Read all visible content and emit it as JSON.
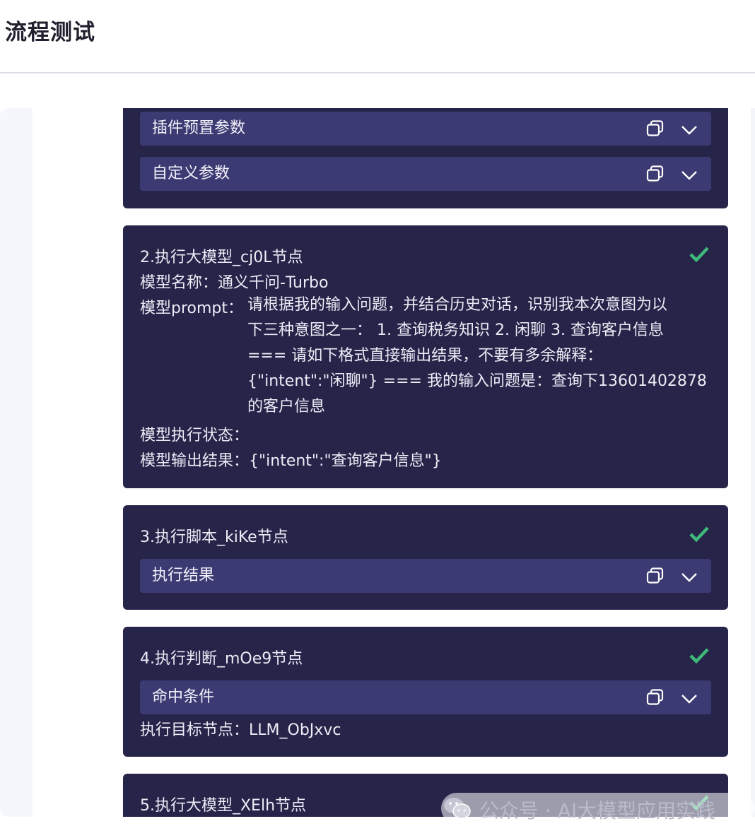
{
  "page": {
    "title": "流程测试"
  },
  "card1": {
    "bars": [
      {
        "label": "插件预置参数",
        "copy_icon": "copy-icon",
        "expand_icon": "chevron-down-icon"
      },
      {
        "label": "自定义参数",
        "copy_icon": "copy-icon",
        "expand_icon": "chevron-down-icon"
      }
    ]
  },
  "card2": {
    "title": "2.执行大模型_cj0L节点",
    "status_icon": "check-icon",
    "model_name_label": "模型名称：",
    "model_name_value": "通义千问-Turbo",
    "prompt_label": "模型prompt：",
    "prompt_lines": [
      "请根据我的输入问题，并结合历史对话，识别我本次意图为以",
      "下三种意图之一： 1. 查询税务知识 2. 闲聊 3. 查询客户信息",
      "=== 请如下格式直接输出结果，不要有多余解释：",
      "{\"intent\":\"闲聊\"} === 我的输入问题是：查询下13601402878",
      "的客户信息"
    ],
    "exec_status_label": "模型执行状态：",
    "output_label": "模型输出结果：",
    "output_value": "{\"intent\":\"查询客户信息\"}"
  },
  "card3": {
    "title": "3.执行脚本_kiKe节点",
    "status_icon": "check-icon",
    "bar_label": "执行结果"
  },
  "card4": {
    "title": "4.执行判断_mOe9节点",
    "status_icon": "check-icon",
    "bar_label": "命中条件",
    "target_label": "执行目标节点：",
    "target_value": "LLM_ObJxvc"
  },
  "card5": {
    "title": "5.执行大模型_XElh节点",
    "status_icon": "check-icon"
  },
  "watermark": {
    "text": "公众号 · AI大模型应用实践",
    "icon": "wechat-icon"
  },
  "colors": {
    "card_bg": "#262449",
    "bar_bg": "#3c3a72",
    "check": "#3fb97a",
    "title_text": "#1f1f2e"
  }
}
